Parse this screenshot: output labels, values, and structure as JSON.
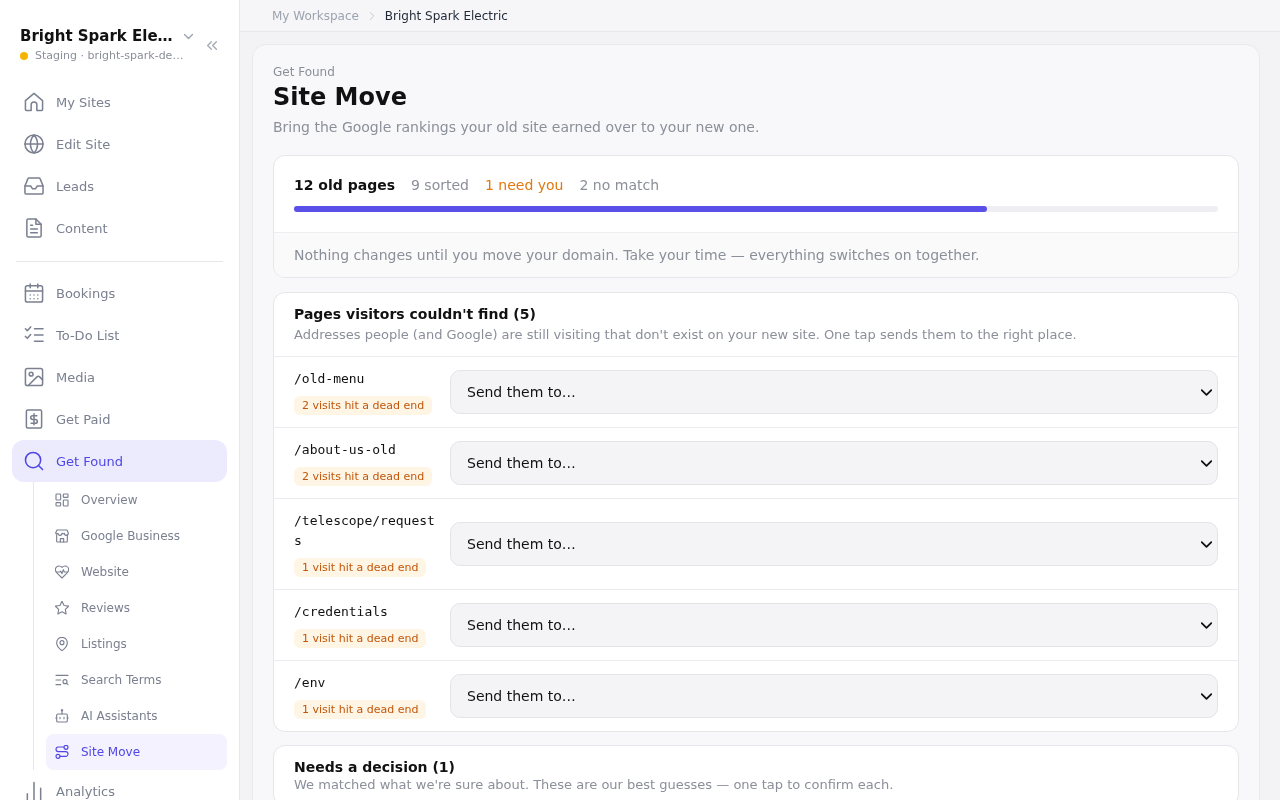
{
  "sidebar": {
    "workspace": {
      "name": "Bright Spark Ele…",
      "status": "Staging · bright-spark-de…"
    },
    "sections": [
      {
        "items": [
          {
            "label": "My Sites",
            "selected": false
          },
          {
            "label": "Edit Site",
            "selected": false
          },
          {
            "label": "Leads",
            "selected": false
          },
          {
            "label": "Content",
            "selected": false
          }
        ]
      },
      {
        "items": [
          {
            "label": "Bookings",
            "selected": false
          },
          {
            "label": "To-Do List",
            "selected": false
          },
          {
            "label": "Media",
            "selected": false
          },
          {
            "label": "Get Paid",
            "selected": false
          },
          {
            "label": "Get Found",
            "selected": true,
            "children": [
              {
                "label": "Overview",
                "selected": false
              },
              {
                "label": "Google Business",
                "selected": false
              },
              {
                "label": "Website",
                "selected": false
              },
              {
                "label": "Reviews",
                "selected": false
              },
              {
                "label": "Listings",
                "selected": false
              },
              {
                "label": "Search Terms",
                "selected": false
              },
              {
                "label": "AI Assistants",
                "selected": false
              },
              {
                "label": "Site Move",
                "selected": true
              }
            ]
          },
          {
            "label": "Analytics",
            "selected": false
          }
        ]
      }
    ]
  },
  "breadcrumb": [
    "My Workspace",
    "Bright Spark Electric"
  ],
  "page": {
    "eyebrow": "Get Found",
    "title": "Site Move",
    "subtitle": "Bring the Google rankings your old site earned over to your new one."
  },
  "progress_card": {
    "stats": [
      {
        "text": "12 old pages",
        "kind": "total"
      },
      {
        "text": "9 sorted",
        "kind": "muted"
      },
      {
        "text": "1 need you",
        "kind": "warning"
      },
      {
        "text": "2 no match",
        "kind": "muted"
      }
    ],
    "level": 0.75,
    "note": "Nothing changes until you move your domain. Take your time — everything switches on together."
  },
  "missing_pages": {
    "title": "Pages visitors couldn't find (5)",
    "description": "Addresses people (and Google) are still visiting that don't exist on your new site. One tap sends them to the right place.",
    "rows": [
      {
        "path": "/old-menu",
        "badge": "2 visits hit a dead end",
        "destination_select": {
          "value": "Send them to…"
        }
      },
      {
        "path": "/about-us-old",
        "badge": "2 visits hit a dead end",
        "destination_select": {
          "value": "Send them to…"
        }
      },
      {
        "path": "/telescope/requests",
        "badge": "1 visit hit a dead end",
        "destination_select": {
          "value": "Send them to…"
        }
      },
      {
        "path": "/credentials",
        "badge": "1 visit hit a dead end",
        "destination_select": {
          "value": "Send them to…"
        }
      },
      {
        "path": "/env",
        "badge": "1 visit hit a dead end",
        "destination_select": {
          "value": "Send them to…"
        }
      }
    ]
  },
  "needs_decision": {
    "title": "Needs a decision (1)",
    "description": "We matched what we're sure about. These are our best guesses — one tap to confirm each."
  }
}
